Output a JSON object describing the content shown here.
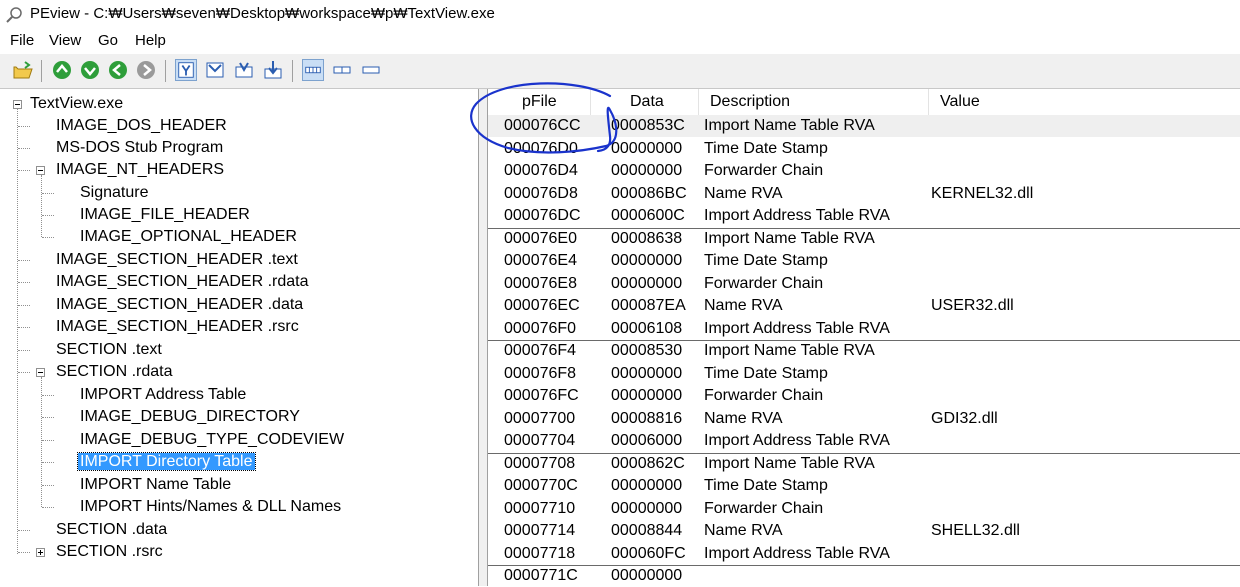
{
  "window": {
    "title": "PEview - C:₩Users₩seven₩Desktop₩workspace₩p₩TextView.exe"
  },
  "menu": [
    "File",
    "View",
    "Go",
    "Help"
  ],
  "toolbar": {
    "buttons": [
      "open-icon",
      "up-icon",
      "down-icon",
      "back-icon",
      "forward-icon",
      "view-hex-icon",
      "view-header-icon",
      "view-import-icon",
      "view-export-icon",
      "view-byte-icon",
      "view-word-icon",
      "view-dword-icon"
    ]
  },
  "tree": {
    "root": "TextView.exe",
    "items": [
      "IMAGE_DOS_HEADER",
      "MS-DOS Stub Program",
      "IMAGE_NT_HEADERS",
      "Signature",
      "IMAGE_FILE_HEADER",
      "IMAGE_OPTIONAL_HEADER",
      "IMAGE_SECTION_HEADER .text",
      "IMAGE_SECTION_HEADER .rdata",
      "IMAGE_SECTION_HEADER .data",
      "IMAGE_SECTION_HEADER .rsrc",
      "SECTION .text",
      "SECTION .rdata",
      "IMPORT Address Table",
      "IMAGE_DEBUG_DIRECTORY",
      "IMAGE_DEBUG_TYPE_CODEVIEW",
      "IMPORT Directory Table",
      "IMPORT Name Table",
      "IMPORT Hints/Names & DLL Names",
      "SECTION .data",
      "SECTION .rsrc"
    ],
    "selected": "IMPORT Directory Table"
  },
  "list": {
    "columns": [
      "pFile",
      "Data",
      "Description",
      "Value"
    ],
    "rows": [
      [
        "000076CC",
        "0000853C",
        "Import Name Table RVA",
        ""
      ],
      [
        "000076D0",
        "00000000",
        "Time Date Stamp",
        ""
      ],
      [
        "000076D4",
        "00000000",
        "Forwarder Chain",
        ""
      ],
      [
        "000076D8",
        "000086BC",
        "Name RVA",
        "KERNEL32.dll"
      ],
      [
        "000076DC",
        "0000600C",
        "Import Address Table RVA",
        ""
      ],
      [
        "000076E0",
        "00008638",
        "Import Name Table RVA",
        ""
      ],
      [
        "000076E4",
        "00000000",
        "Time Date Stamp",
        ""
      ],
      [
        "000076E8",
        "00000000",
        "Forwarder Chain",
        ""
      ],
      [
        "000076EC",
        "000087EA",
        "Name RVA",
        "USER32.dll"
      ],
      [
        "000076F0",
        "00006108",
        "Import Address Table RVA",
        ""
      ],
      [
        "000076F4",
        "00008530",
        "Import Name Table RVA",
        ""
      ],
      [
        "000076F8",
        "00000000",
        "Time Date Stamp",
        ""
      ],
      [
        "000076FC",
        "00000000",
        "Forwarder Chain",
        ""
      ],
      [
        "00007700",
        "00008816",
        "Name RVA",
        "GDI32.dll"
      ],
      [
        "00007704",
        "00006000",
        "Import Address Table RVA",
        ""
      ],
      [
        "00007708",
        "0000862C",
        "Import Name Table RVA",
        ""
      ],
      [
        "0000770C",
        "00000000",
        "Time Date Stamp",
        ""
      ],
      [
        "00007710",
        "00000000",
        "Forwarder Chain",
        ""
      ],
      [
        "00007714",
        "00008844",
        "Name RVA",
        "SHELL32.dll"
      ],
      [
        "00007718",
        "000060FC",
        "Import Address Table RVA",
        ""
      ],
      [
        "0000771C",
        "00000000",
        "",
        ""
      ]
    ]
  },
  "colors": {
    "selection": "#3399ff",
    "annotation": "#1a33cc",
    "toolbar_green": "#2e9e3a"
  }
}
